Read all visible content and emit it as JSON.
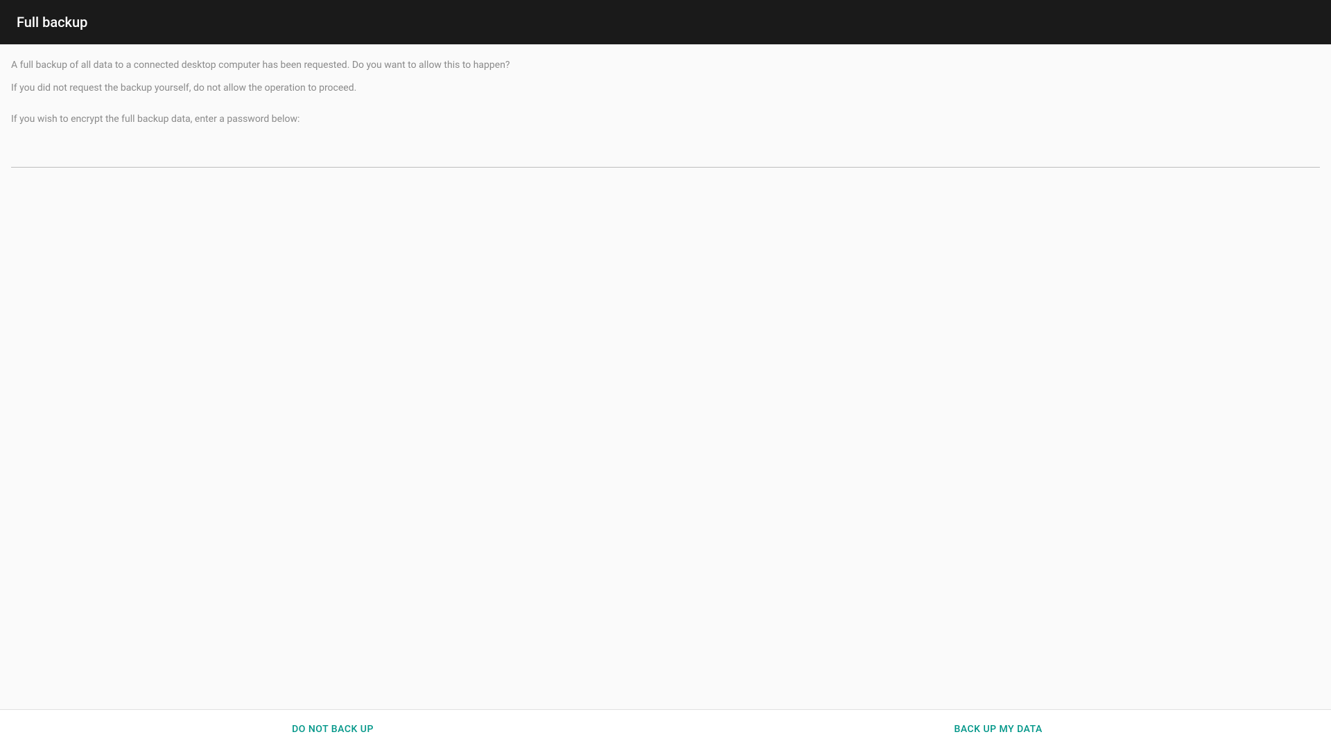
{
  "header": {
    "title": "Full backup"
  },
  "content": {
    "description_line1": "A full backup of all data to a connected desktop computer has been requested. Do you want to allow this to happen?",
    "description_line2": "If you did not request the backup yourself, do not allow the operation to proceed.",
    "encrypt_prompt": "If you wish to encrypt the full backup data, enter a password below:",
    "password_value": ""
  },
  "footer": {
    "deny_label": "Do not back up",
    "allow_label": "Back up my data"
  },
  "colors": {
    "header_bg": "#1a1a1a",
    "accent": "#009688",
    "body_bg": "#fafafa",
    "text_secondary": "#8a8a8a"
  }
}
